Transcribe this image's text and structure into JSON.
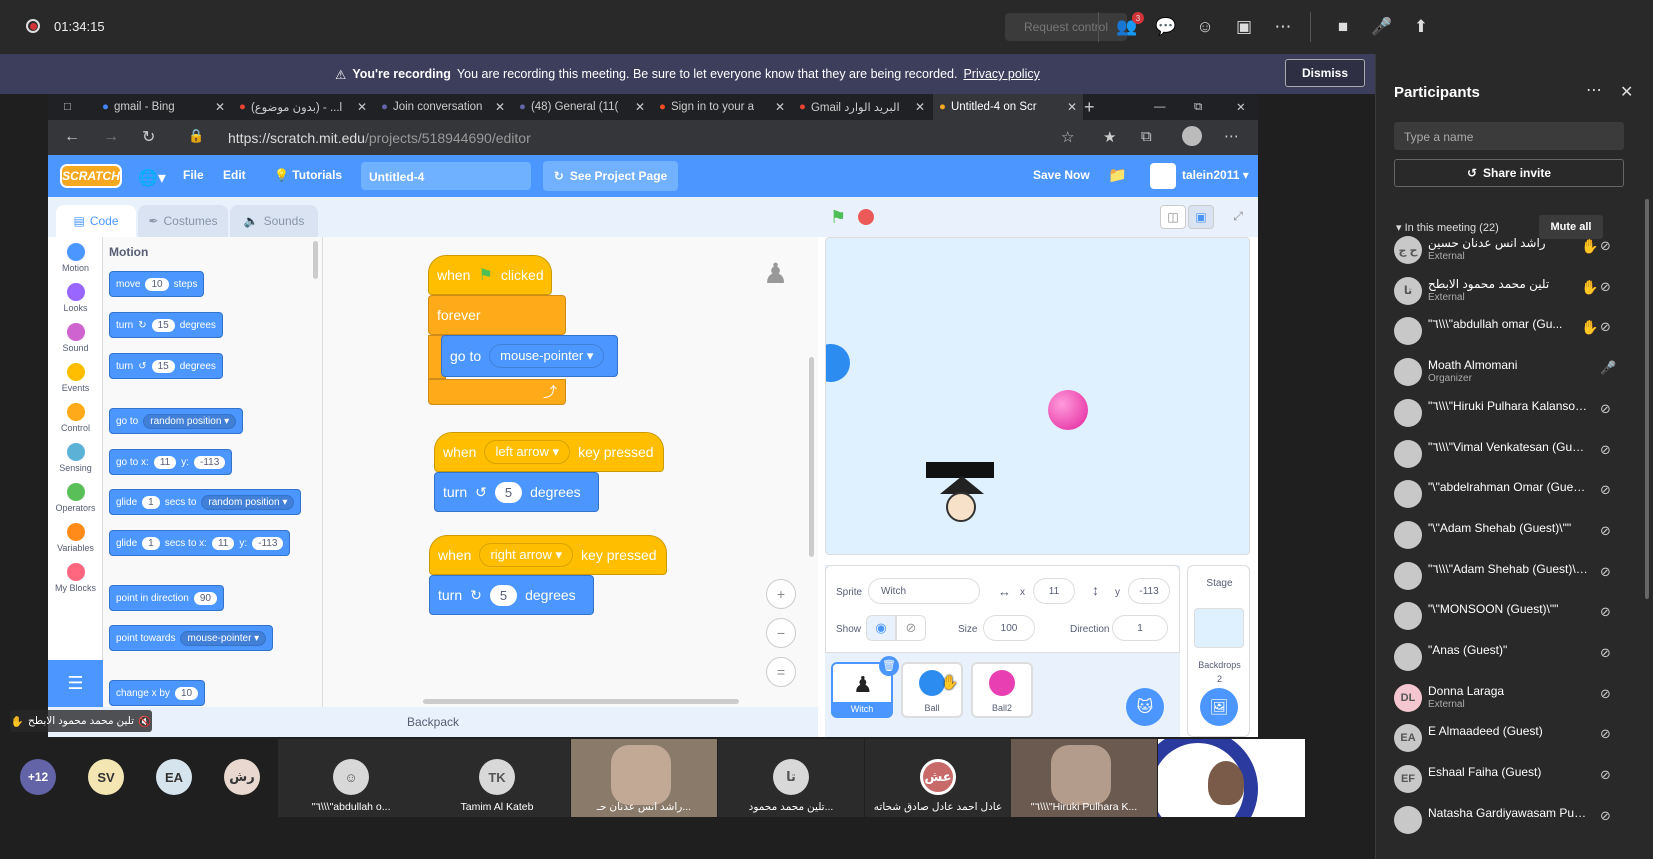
{
  "teams": {
    "timer": "01:34:15",
    "request_control": "Request control",
    "people_badge": "3"
  },
  "banner": {
    "title": "You're recording",
    "text": "You are recording this meeting. Be sure to let everyone know that they are being recorded.",
    "link": "Privacy policy",
    "dismiss": "Dismiss"
  },
  "participants": {
    "title": "Participants",
    "search_placeholder": "Type a name",
    "share": "Share invite",
    "in_meeting": "In this meeting (22)",
    "mute_all": "Mute all",
    "list": [
      {
        "initials": "ح ج",
        "name": "راشد انس عدنان حسين",
        "sub": "External",
        "hand": true
      },
      {
        "initials": "تا",
        "name": "تلين محمد محمود الابطح",
        "sub": "External",
        "hand": true
      },
      {
        "initials": "",
        "name": "\"٦\\\\\\\"abdullah omar (Gu...",
        "sub": "",
        "hand": true
      },
      {
        "initials": "",
        "name": "Moath Almomani",
        "sub": "Organizer",
        "hand": false
      },
      {
        "initials": "",
        "name": "\"٦\\\\\\\"Hiruki Pulhara Kalansoo...",
        "sub": "",
        "hand": false
      },
      {
        "initials": "",
        "name": "\"٦\\\\\\\"Vimal Venkatesan (Gue...",
        "sub": "",
        "hand": false
      },
      {
        "initials": "",
        "name": "\"\\\"abdelrahman Omar (Guest)\"",
        "sub": "",
        "hand": false
      },
      {
        "initials": "",
        "name": "\"\\\"Adam Shehab (Guest)\\\"\"",
        "sub": "",
        "hand": false
      },
      {
        "initials": "",
        "name": "\"٦\\\\\\\"Adam Shehab (Guest)\\\\...",
        "sub": "",
        "hand": false
      },
      {
        "initials": "",
        "name": "\"\\\"MONSOON (Guest)\\\"\"",
        "sub": "",
        "hand": false
      },
      {
        "initials": "",
        "name": "\"Anas (Guest)\"",
        "sub": "",
        "hand": false
      },
      {
        "initials": "DL",
        "name": "Donna Laraga",
        "sub": "External",
        "hand": false
      },
      {
        "initials": "EA",
        "name": "E Almaadeed (Guest)",
        "sub": "",
        "hand": false
      },
      {
        "initials": "EF",
        "name": "Eshaal Faiha (Guest)",
        "sub": "",
        "hand": false
      },
      {
        "initials": "",
        "name": "Natasha Gardiyawasam Punc...",
        "sub": "",
        "hand": false
      }
    ]
  },
  "browser": {
    "tabs": [
      "gmail - Bing",
      "(بدون موضوع) - ...l",
      "Join conversation",
      "(48) General (11(",
      "Sign in to your a",
      "Gmail البريد الوارد",
      "Untitled-4 on Scr"
    ],
    "url_host": "https://scratch.mit.edu",
    "url_path": "/projects/518944690/editor"
  },
  "scratch": {
    "logo": "SCRATCH",
    "menu": {
      "file": "File",
      "edit": "Edit",
      "tutorials": "Tutorials",
      "see_project": "See Project Page",
      "save_now": "Save Now",
      "user": "talein2011"
    },
    "project_name": "Untitled-4",
    "tabs": {
      "code": "Code",
      "costumes": "Costumes",
      "sounds": "Sounds"
    },
    "categories": [
      {
        "name": "Motion",
        "color": "#4c97ff"
      },
      {
        "name": "Looks",
        "color": "#9966ff"
      },
      {
        "name": "Sound",
        "color": "#cf63cf"
      },
      {
        "name": "Events",
        "color": "#ffbf00"
      },
      {
        "name": "Control",
        "color": "#ffab19"
      },
      {
        "name": "Sensing",
        "color": "#5cb1d6"
      },
      {
        "name": "Operators",
        "color": "#59c059"
      },
      {
        "name": "Variables",
        "color": "#ff8c1a"
      },
      {
        "name": "My Blocks",
        "color": "#ff6680"
      }
    ],
    "palette": {
      "header": "Motion",
      "move": "move",
      "move_n": "10",
      "steps": "steps",
      "turn": "turn",
      "turn_n": "15",
      "degrees": "degrees",
      "goto": "go to",
      "random": "random position",
      "gotoxy": "go to x:",
      "x": "11",
      "y_label": "y:",
      "y": "-113",
      "glide": "glide",
      "one": "1",
      "secs_to": "secs to",
      "secs_to_x": "secs to x:",
      "point_dir": "point in direction",
      "dir": "90",
      "point_towards": "point towards",
      "mouse_pointer": "mouse-pointer",
      "change_x": "change x by",
      "cx": "10"
    },
    "script": {
      "when": "when",
      "clicked": "clicked",
      "forever": "forever",
      "goto": "go to",
      "mouse_pointer": "mouse-pointer",
      "left_arrow": "left arrow",
      "right_arrow": "right arrow",
      "key_pressed": "key pressed",
      "turn": "turn",
      "five": "5",
      "degrees": "degrees"
    },
    "backpack": "Backpack",
    "sprite": {
      "label": "Sprite",
      "name": "Witch",
      "x_label": "x",
      "x": "11",
      "y_label": "y",
      "y": "-113",
      "show": "Show",
      "size_label": "Size",
      "size": "100",
      "direction_label": "Direction",
      "direction": "1"
    },
    "sprites": [
      "Witch",
      "Ball",
      "Ball2"
    ],
    "stage": {
      "label": "Stage",
      "backdrops": "Backdrops",
      "backdrop_count": "2"
    }
  },
  "gallery": {
    "overflow": "+12",
    "avatars": [
      {
        "initials": "SV",
        "color": "#f4e6b3"
      },
      {
        "initials": "EA",
        "color": "#d6e4ee"
      },
      {
        "initials": "رش",
        "color": "#e8d8d0"
      }
    ],
    "tiles": [
      {
        "name": "\"٦\\\\\\\"abdullah o...",
        "initials": ""
      },
      {
        "name": "Tamim Al Kateb",
        "initials": "TK"
      },
      {
        "name": "راشد انس عدنان حـ...",
        "initials": ""
      },
      {
        "name": "تلين محمد محمود...",
        "initials": "تا"
      },
      {
        "name": "عادل احمد عادل صادق شحاته",
        "initials": "عش"
      },
      {
        "name": "\"٦\\\\\\\"Hiruki Pulhara K...",
        "initials": ""
      }
    ],
    "nametag": "تلين محمد محمود الابطح"
  }
}
